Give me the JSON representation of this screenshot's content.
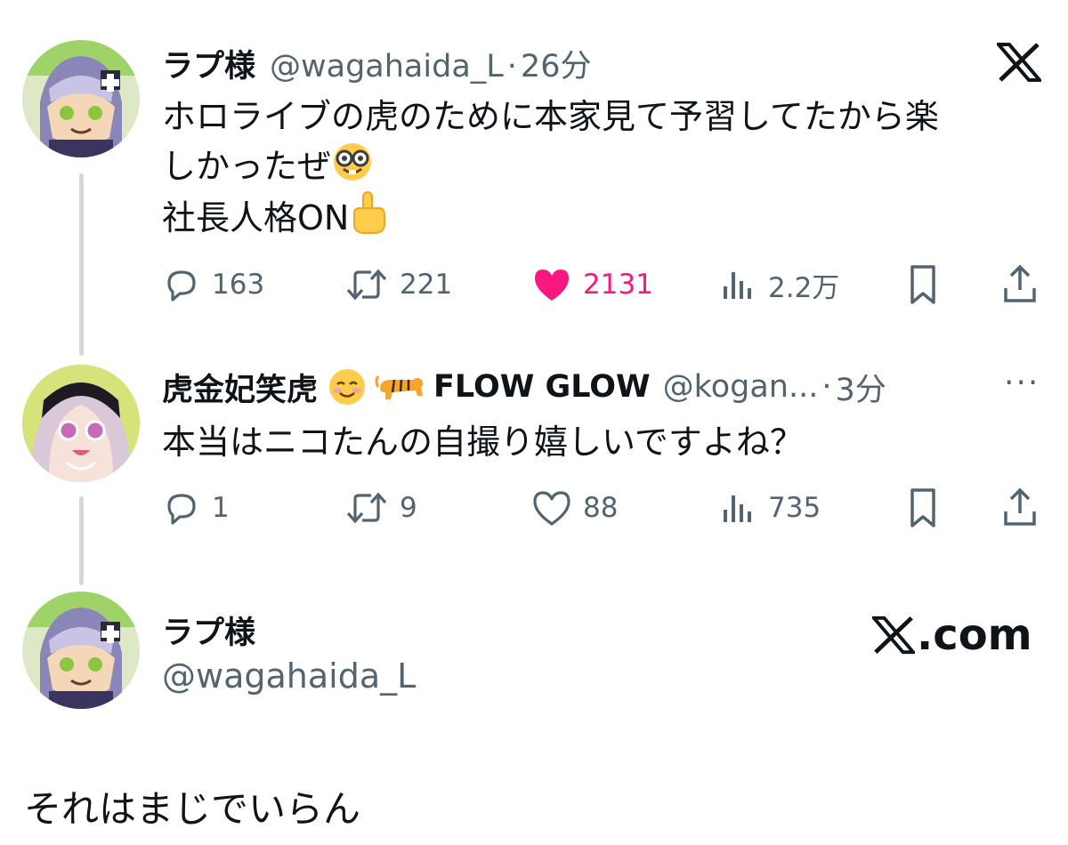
{
  "tweet1": {
    "name": "ラプ様",
    "handle": "@wagahaida_L",
    "separator": "·",
    "time": "26分",
    "line1": "ホロライブの虎のために本家見て予習してたから楽",
    "line2": "しかったぜ",
    "line3": "社長人格ON",
    "replies": "163",
    "retweets": "221",
    "likes": "2131",
    "views": "2.2万",
    "liked": true
  },
  "tweet2": {
    "name": "虎金妃笑虎",
    "name_suffix": "FLOW GLOW",
    "handle": "@kogan...",
    "separator": "·",
    "time": "3分",
    "more": "···",
    "text": "本当はニコたんの自撮り嬉しいですよね？",
    "replies": "1",
    "retweets": "9",
    "likes": "88",
    "views": "735",
    "liked": false
  },
  "profile_card": {
    "name": "ラプ様",
    "handle": "@wagahaida_L",
    "brand_text": ".com"
  },
  "caption": "それはまじでいらん",
  "icons": {
    "reply": "reply-icon",
    "retweet": "retweet-icon",
    "like": "heart-icon",
    "views": "views-icon",
    "bookmark": "bookmark-icon",
    "share": "share-icon",
    "x_logo": "x-logo-icon"
  },
  "colors": {
    "text": "#0f1419",
    "secondary": "#536471",
    "like": "#f91880",
    "thread_line": "#cfd9de"
  }
}
